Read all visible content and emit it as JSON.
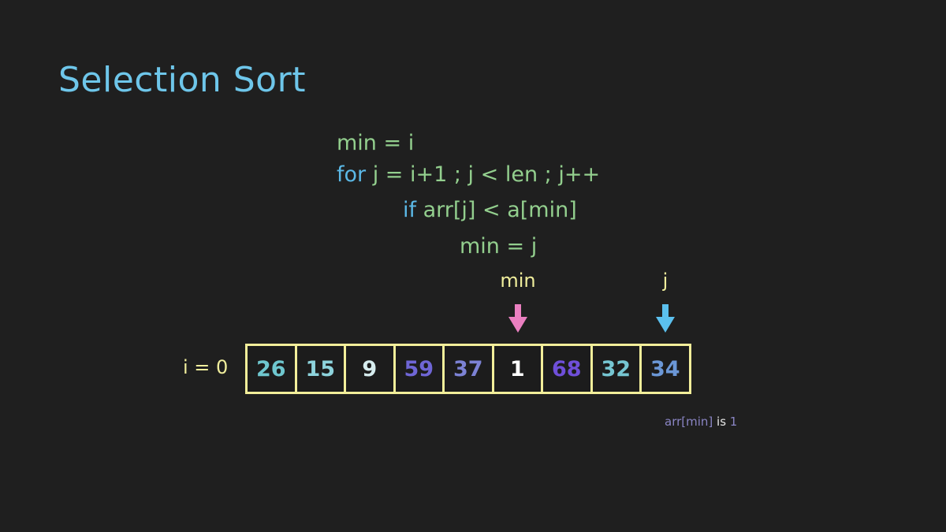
{
  "title": "Selection Sort",
  "code": {
    "line1": "min = i",
    "line2_kw": "for",
    "line2_rest": " j = i+1 ; j < len ; j++",
    "line3_kw": "if",
    "line3_rest": " arr[j] < a[min]",
    "line4": "min = j"
  },
  "pointers": {
    "min_label": "min",
    "min_index": 5,
    "min_color": "#ea7fc0",
    "j_label": "j",
    "j_index": 8,
    "j_color": "#5bc0ee"
  },
  "iteration_label": "i = 0",
  "array": [
    {
      "value": "26",
      "color": "#6fc7cf"
    },
    {
      "value": "15",
      "color": "#8dd3dc"
    },
    {
      "value": "9",
      "color": "#d6ecee"
    },
    {
      "value": "59",
      "color": "#6f66d6"
    },
    {
      "value": "37",
      "color": "#7c82d4"
    },
    {
      "value": "1",
      "color": "#ffffff"
    },
    {
      "value": "68",
      "color": "#6f4fd9"
    },
    {
      "value": "32",
      "color": "#76c6d2"
    },
    {
      "value": "34",
      "color": "#6b97d6"
    }
  ],
  "note": {
    "prefix": "arr[min]",
    "middle": " is ",
    "value": "1"
  },
  "colors": {
    "background": "#1f1f1f",
    "title": "#6ec6ea",
    "array_border": "#f2ee9a"
  }
}
